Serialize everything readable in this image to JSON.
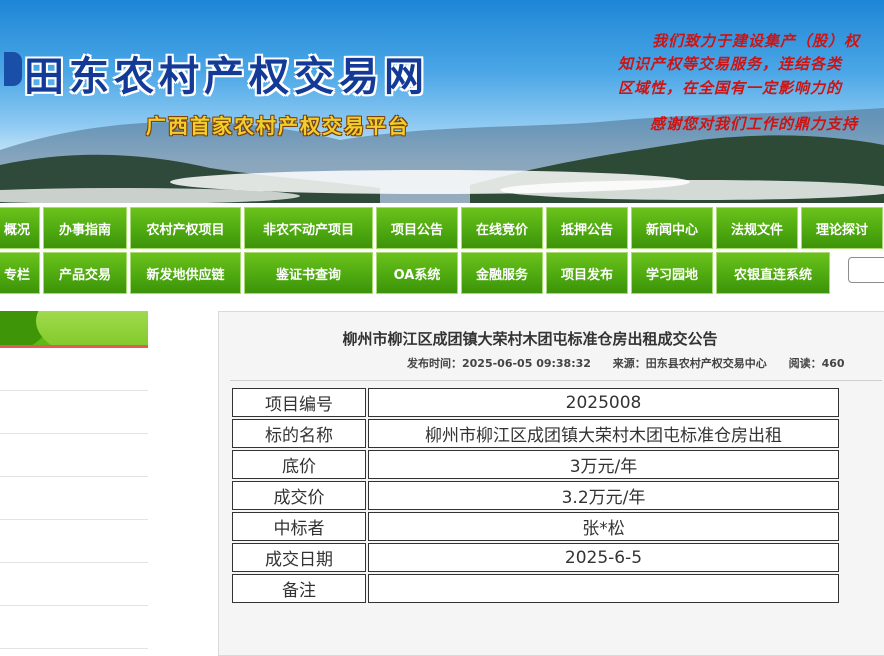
{
  "banner": {
    "site_title": "田东农村产权交易网",
    "site_subtitle": "广西首家农村产权交易平台",
    "slogans": [
      "我们致力于建设集产（股）权",
      "知识产权等交易服务，连结各类",
      "区域性，在全国有一定影响力的",
      "感谢您对我们工作的鼎力支持"
    ]
  },
  "nav": {
    "row1": [
      "概况",
      "办事指南",
      "农村产权项目",
      "非农不动产项目",
      "项目公告",
      "在线竞价",
      "抵押公告",
      "新闻中心",
      "法规文件",
      "理论探讨"
    ],
    "row2": [
      "专栏",
      "产品交易",
      "新发地供应链",
      "鉴证书查询",
      "OA系统",
      "金融服务",
      "项目发布",
      "学习园地",
      "农银直连系统"
    ],
    "search_placeholder": ""
  },
  "article": {
    "title": "柳州市柳江区成团镇大荣村木团屯标准仓房出租成交公告",
    "publish_time": "发布时间：2025-06-05 09:38:32",
    "source": "来源：田东县农村产权交易中心",
    "reads": "阅读：460",
    "table": [
      {
        "key": "项目编号",
        "value": "2025008"
      },
      {
        "key": "标的名称",
        "value": "柳州市柳江区成团镇大荣村木团屯标准仓房出租"
      },
      {
        "key": "底价",
        "value": "3万元/年"
      },
      {
        "key": "成交价",
        "value": "3.2万元/年"
      },
      {
        "key": "中标者",
        "value": "张*松"
      },
      {
        "key": "成交日期",
        "value": "2025-6-5"
      },
      {
        "key": "备注",
        "value": ""
      }
    ]
  },
  "colors": {
    "nav_green": "#4faa10",
    "title_blue": "#123a96",
    "subtitle_gold": "#f1cd2e",
    "slogan_red": "#cc1414"
  }
}
